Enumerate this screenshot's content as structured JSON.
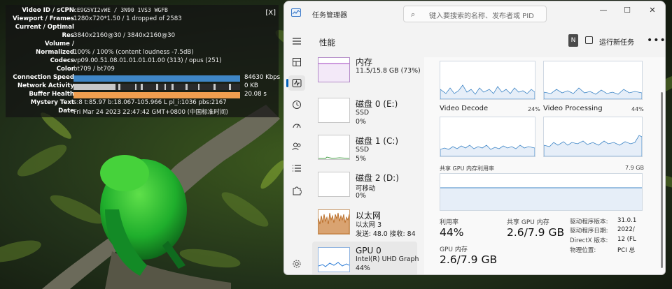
{
  "stats": {
    "close_label": "[X]",
    "rows": [
      {
        "label": "Video ID / sCPN",
        "value": "cE9G5VI2vWE / 3N90 1VS3 WGFB",
        "mono": true
      },
      {
        "label": "Viewport / Frames",
        "value": "1280x720*1.50 / 1 dropped of 2583"
      },
      {
        "label": "Current / Optimal",
        "value": ""
      },
      {
        "label": "Res",
        "value": "3840x2160@30 / 3840x2160@30"
      },
      {
        "label": "Volume /",
        "value": ""
      },
      {
        "label": "Normalized",
        "value": "100% / 100% (content loudness -7.5dB)"
      },
      {
        "label": "Codecs",
        "value": "vp09.00.51.08.01.01.01.01.00 (313) / opus (251)"
      },
      {
        "label": "Color",
        "value": "bt709 / bt709"
      }
    ],
    "bars": [
      {
        "label": "Connection Speed",
        "value": "84630 Kbps",
        "color": "#3f86c6",
        "fill": 1.0
      },
      {
        "label": "Network Activity",
        "value": "0 KB",
        "color": "#b0b0b0",
        "fill": 1.0
      },
      {
        "label": "Buffer Health",
        "value": "20.08 s",
        "color": "#ef9e4f",
        "fill": 1.0
      }
    ],
    "tail_rows": [
      {
        "label": "Mystery Text",
        "value": "s:8 t:85.97 b:18.067-105.966 L pl_i:1036 pbs:2167"
      },
      {
        "label": "Date",
        "value": "Fri Mar 24 2023 22:47:42 GMT+0800 (中国标准时间)"
      }
    ]
  },
  "taskmanager": {
    "title": "任务管理器",
    "search_placeholder": "键入要搜索的名称、发布者或 PID",
    "page_title": "性能",
    "user_initial": "N",
    "new_task_label": "运行新任务",
    "more_label": "•••",
    "window_controls": {
      "minimize": "—",
      "maximize": "☐",
      "close": "✕"
    },
    "devices": [
      {
        "name": "内存",
        "lines": [
          "11.5/15.8 GB (73%)"
        ],
        "color": "#a040c0"
      },
      {
        "name": "磁盘 0 (E:)",
        "lines": [
          "SSD",
          "0%"
        ],
        "color": "#4aa04a"
      },
      {
        "name": "磁盘 1 (C:)",
        "lines": [
          "SSD",
          "5%"
        ],
        "color": "#4aa04a"
      },
      {
        "name": "磁盘 2 (D:)",
        "lines": [
          "可移动",
          "0%"
        ],
        "color": "#4aa04a"
      },
      {
        "name": "以太网",
        "lines": [
          "以太网 3",
          "发送: 48.0  接收: 84"
        ],
        "color": "#b5651d"
      },
      {
        "name": "GPU 0",
        "lines": [
          "Intel(R) UHD Graph",
          "44%"
        ],
        "color": "#2b7bd6"
      }
    ],
    "engines": [
      {
        "name": "Video Decode",
        "pct": "24%"
      },
      {
        "name": "Video Processing",
        "pct": "44%"
      }
    ],
    "shared_memory_label": "共享 GPU 内存利用率",
    "shared_memory_max": "7.9 GB",
    "kpis": {
      "util_label": "利用率",
      "util_value": "44%",
      "shared_label": "共享 GPU 内存",
      "shared_value": "2.6/7.9 GB",
      "mem_label": "GPU 内存",
      "mem_value": "2.6/7.9 GB"
    },
    "props": [
      {
        "label": "驱动程序版本:",
        "value": "31.0.1"
      },
      {
        "label": "驱动程序日期:",
        "value": "2022/"
      },
      {
        "label": "DirectX 版本:",
        "value": "12 (FL"
      },
      {
        "label": "物理位置:",
        "value": "PCI 总"
      }
    ]
  }
}
